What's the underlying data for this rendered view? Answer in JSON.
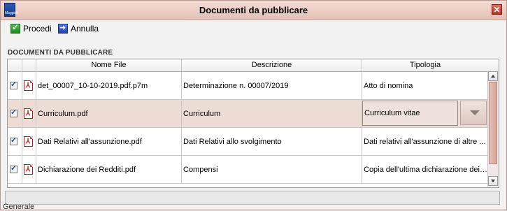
{
  "window": {
    "title": "Documenti da pubblicare",
    "app_icon_label": "Maggioli",
    "close_glyph": "✕"
  },
  "toolbar": {
    "procedi_label": "Procedi",
    "annulla_label": "Annulla"
  },
  "section": {
    "label": "DOCUMENTI DA PUBBLICARE"
  },
  "table": {
    "columns": [
      "",
      "",
      "Nome File",
      "Descrizione",
      "Tipologia"
    ],
    "rows": [
      {
        "checked": true,
        "nome_file": "det_00007_10-10-2019.pdf.p7m",
        "descrizione": "Determinazione n. 00007/2019",
        "tipologia": "Atto di nomina"
      },
      {
        "checked": true,
        "nome_file": "Curriculum.pdf",
        "descrizione": "Curriculum",
        "tipologia": "Curriculum vitae"
      },
      {
        "checked": true,
        "nome_file": "Dati Relativi all'assunzione.pdf",
        "descrizione": "Dati Relativi allo svolgimento",
        "tipologia": "Dati relativi all'assunzione di altre ..."
      },
      {
        "checked": true,
        "nome_file": "Dichiarazione dei Redditi.pdf",
        "descrizione": "Compensi",
        "tipologia": "Copia dell'ultima dichiarazione dei ..."
      }
    ],
    "selected_row": 1
  },
  "background_tab": {
    "label": "Generale"
  },
  "colors": {
    "titlebar": "#e8cac2",
    "selected_row": "#ecdcd4",
    "scroll_thumb": "#dca89c"
  }
}
